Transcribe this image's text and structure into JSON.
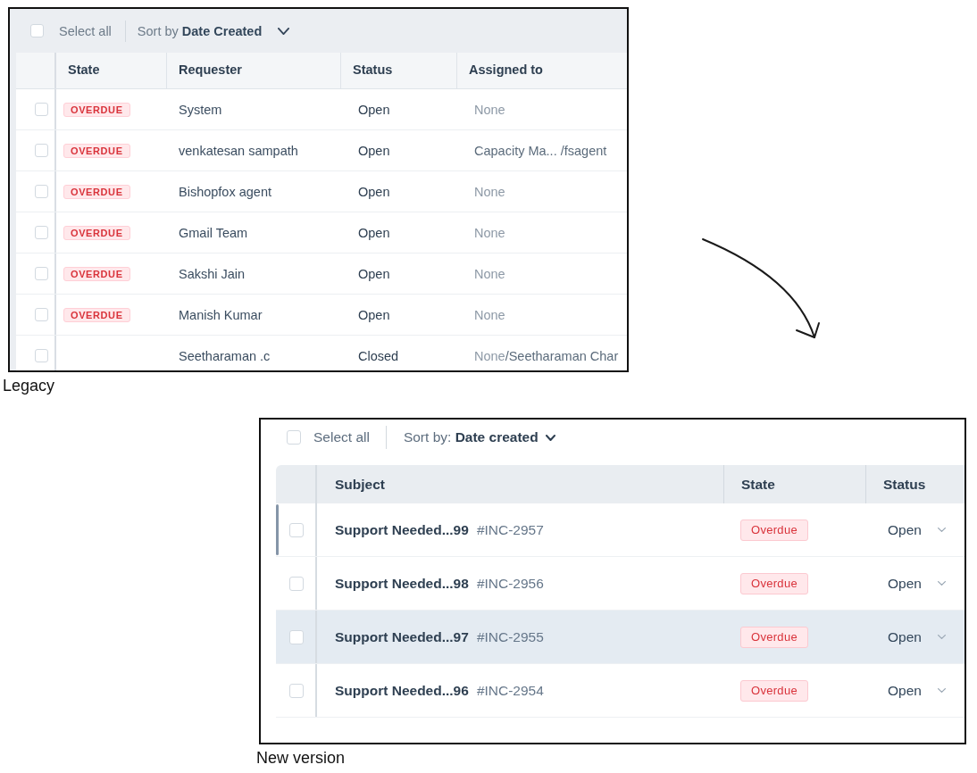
{
  "legacy": {
    "toolbar": {
      "select_all": {
        "label": "Select all",
        "checked": false
      },
      "sort": {
        "label": "Sort by **Date Created**"
      }
    },
    "columns": [
      "State",
      "Requester",
      "Status",
      "Assigned to"
    ],
    "rows": [
      {
        "checked": false,
        "state": "OVERDUE",
        "requester": "System",
        "status": "Open",
        "assigned": [
          {
            "text": "None",
            "muted": true
          }
        ]
      },
      {
        "checked": false,
        "state": "OVERDUE",
        "requester": "venkatesan sampath",
        "status": "Open",
        "assigned": [
          {
            "text": "Capacity Ma... /fsagent",
            "muted": false
          }
        ]
      },
      {
        "checked": false,
        "state": "OVERDUE",
        "requester": "Bishopfox agent",
        "status": "Open",
        "assigned": [
          {
            "text": "None",
            "muted": true
          }
        ]
      },
      {
        "checked": false,
        "state": "OVERDUE",
        "requester": "Gmail Team",
        "status": "Open",
        "assigned": [
          {
            "text": "None",
            "muted": true
          }
        ]
      },
      {
        "checked": false,
        "state": "OVERDUE",
        "requester": "Sakshi Jain",
        "status": "Open",
        "assigned": [
          {
            "text": "None",
            "muted": true
          }
        ]
      },
      {
        "checked": false,
        "state": "OVERDUE",
        "requester": "Manish Kumar",
        "status": "Open",
        "assigned": [
          {
            "text": "None",
            "muted": true
          }
        ]
      },
      {
        "checked": false,
        "requester": "Seetharaman .c",
        "status": "Closed",
        "assigned": [
          {
            "text": "None",
            "muted": true
          },
          {
            "text": "/Seetharaman Char",
            "muted": false
          }
        ]
      }
    ],
    "caption": "Legacy"
  },
  "new_version": {
    "toolbar": {
      "select_all": {
        "label": "Select all",
        "checked": false
      },
      "sort": {
        "label": "Sort by: **Date created**"
      }
    },
    "columns": [
      "Subject",
      "State",
      "Status"
    ],
    "rows": [
      {
        "checked": false,
        "focused": true,
        "highlighted": false,
        "subject": "Support Needed...99",
        "ticket_id": "#INC-2957",
        "state": "Overdue",
        "status": "Open"
      },
      {
        "checked": false,
        "focused": false,
        "highlighted": false,
        "subject": "Support Needed...98",
        "ticket_id": "#INC-2956",
        "state": "Overdue",
        "status": "Open"
      },
      {
        "checked": false,
        "focused": false,
        "highlighted": true,
        "subject": "Support Needed...97",
        "ticket_id": "#INC-2955",
        "state": "Overdue",
        "status": "Open"
      },
      {
        "checked": false,
        "focused": false,
        "highlighted": false,
        "subject": "Support Needed...96",
        "ticket_id": "#INC-2954",
        "state": "Overdue",
        "status": "Open"
      }
    ],
    "caption": "New version"
  }
}
